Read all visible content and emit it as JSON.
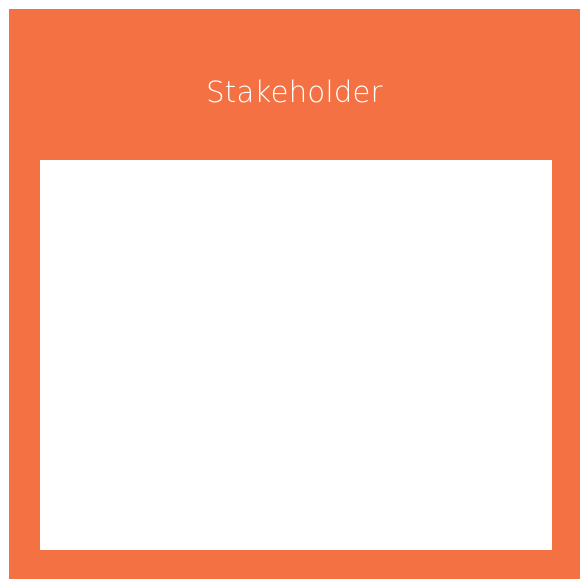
{
  "card": {
    "title": "Stakeholder",
    "body_text": "",
    "accent_color": "#F37142",
    "body_color": "#FFFFFF"
  }
}
